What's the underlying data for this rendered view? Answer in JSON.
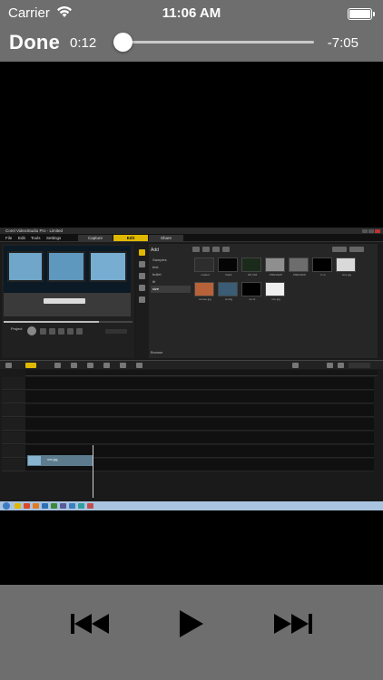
{
  "status_bar": {
    "carrier": "Carrier",
    "time": "11:06 AM",
    "wifi_icon": "wifi-icon",
    "battery_icon": "battery-icon"
  },
  "player_controls": {
    "done_label": "Done",
    "elapsed": "0:12",
    "remaining": "-7:05",
    "progress_fraction": 0.04
  },
  "video_content": {
    "app_title": "Corel VideoStudio Pro - Limited",
    "menus": [
      "File",
      "Edit",
      "Tools",
      "Settings"
    ],
    "steps": [
      "Capture",
      "Edit",
      "Share"
    ],
    "active_step": "Edit",
    "library": {
      "add_label": "Add",
      "folders": [
        "Samples",
        "test",
        "bullet",
        "ttl",
        "size"
      ],
      "selected_folder": "size",
      "browse_label": "Browse",
      "thumb_captions": [
        "rotated",
        "black",
        "SP-V04",
        "PREVIEW",
        "PREVIEW",
        "h-xt",
        "size.jpg",
        "sunset.jpg",
        "sunbg",
        "sv-v1",
        "mm.jpg"
      ]
    },
    "timeline_clip": "mm.jpg",
    "player_label": "Project"
  },
  "bottom_controls": {
    "rewind_icon": "skip-back-icon",
    "play_icon": "play-icon",
    "forward_icon": "skip-forward-icon"
  },
  "colors": {
    "chrome": "#6e6e6e",
    "video_bg": "#000000",
    "accent_yellow": "#e0b800"
  }
}
